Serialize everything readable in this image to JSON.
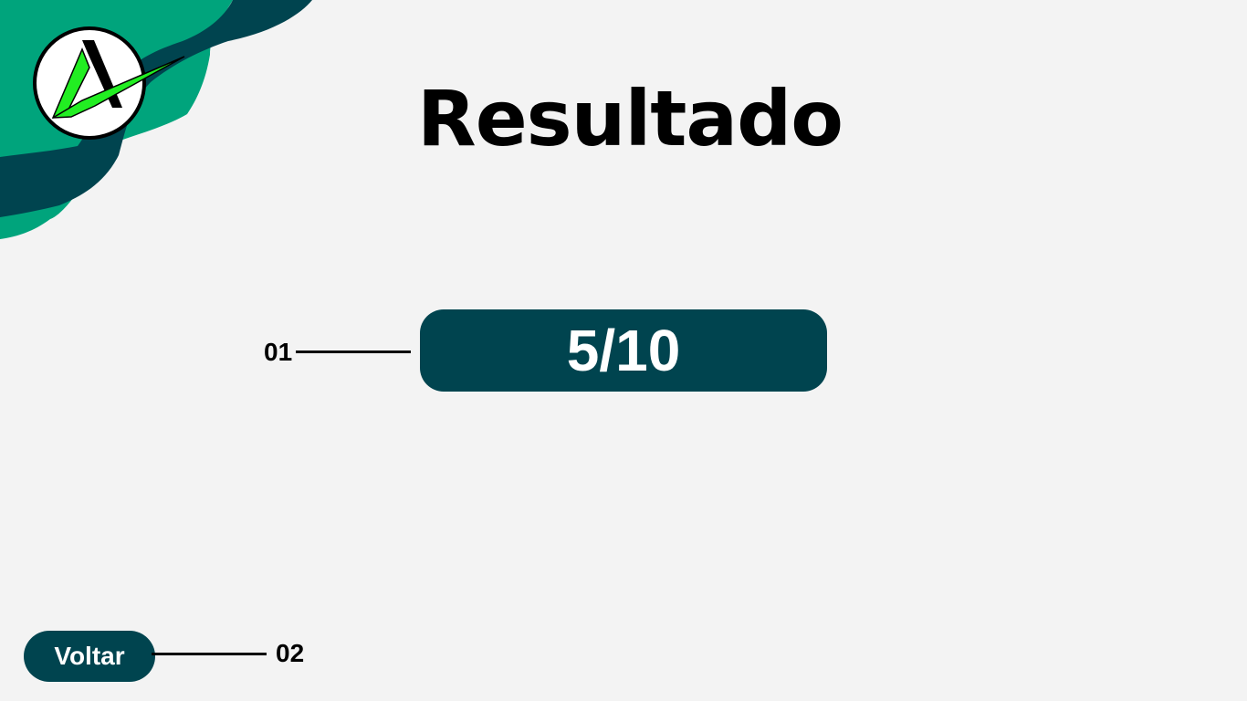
{
  "title": "Resultado",
  "score": {
    "value": "5/10",
    "correct": 5,
    "total": 10
  },
  "callouts": {
    "score_marker": "01",
    "back_marker": "02"
  },
  "back_button": {
    "label": "Voltar"
  },
  "logo": {
    "icon": "stylized-A-checkmark-logo"
  },
  "colors": {
    "background": "#f3f3f3",
    "dark_teal": "#00444f",
    "teal_green": "#00a47c",
    "logo_green": "#22ee22",
    "text": "#000000",
    "button_text": "#ffffff"
  }
}
